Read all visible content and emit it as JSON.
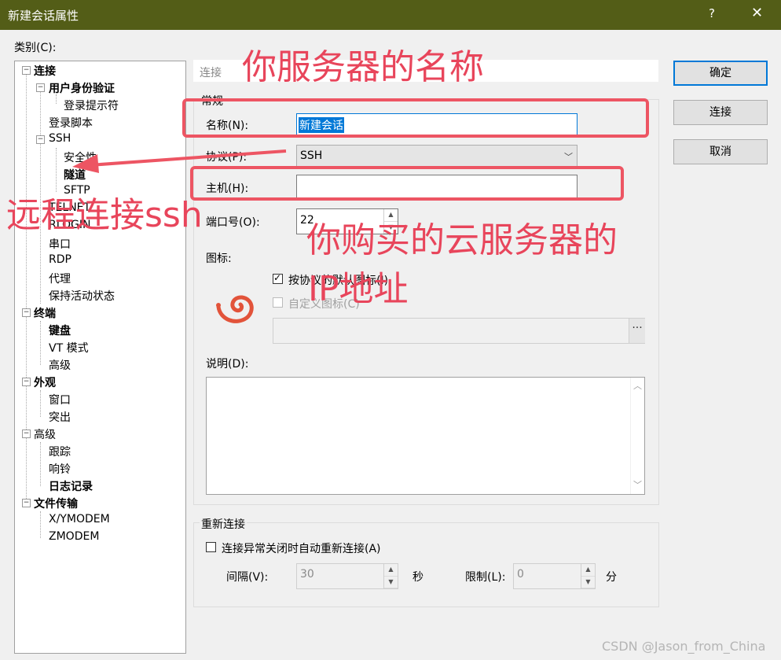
{
  "window": {
    "title": "新建会话属性",
    "help_icon": "?",
    "close_icon": "✕"
  },
  "category_label": "类别(C):",
  "tree": {
    "connection": "连接",
    "user_auth": "用户身份验证",
    "login_prompt": "登录提示符",
    "login_script": "登录脚本",
    "ssh": "SSH",
    "security": "安全性",
    "tunnel": "隧道",
    "sftp": "SFTP",
    "telnet": "TELNET",
    "rlogin": "RLOGIN",
    "serial": "串口",
    "rdp": "RDP",
    "proxy": "代理",
    "keepalive": "保持活动状态",
    "terminal": "终端",
    "keyboard": "键盘",
    "vt_mode": "VT 模式",
    "advanced": "高级",
    "appearance": "外观",
    "window": "窗口",
    "highlight": "突出",
    "advanced2": "高级",
    "trace": "跟踪",
    "bell": "响铃",
    "logging": "日志记录",
    "file_transfer": "文件传输",
    "xymodem": "X/YMODEM",
    "zmodem": "ZMODEM"
  },
  "panel": {
    "header": "连接",
    "general_group": "常规",
    "name_label": "名称(N):",
    "name_value": "新建会话",
    "protocol_label": "协议(P):",
    "protocol_value": "SSH",
    "host_label": "主机(H):",
    "host_value": "",
    "port_label": "端口号(O):",
    "port_value": "22",
    "icon_label": "图标:",
    "use_protocol_icon": "按协议的默认图标(I)",
    "custom_icon": "自定义图标(C)",
    "browse": "...",
    "desc_label": "说明(D):",
    "reconnect_group": "重新连接",
    "reconnect_check": "连接异常关闭时自动重新连接(A)",
    "interval_label": "间隔(V):",
    "interval_value": "30",
    "seconds": "秒",
    "limit_label": "限制(L):",
    "limit_value": "0",
    "minutes": "分"
  },
  "buttons": {
    "ok": "确定",
    "connect": "连接",
    "cancel": "取消"
  },
  "annotations": {
    "server_name": "你服务器的名称",
    "remote_ssh": "远程连接ssh",
    "ip_line1": "你购买的云服务器的",
    "ip_line2": "IP地址"
  },
  "watermark": "CSDN @Jason_from_China",
  "colors": {
    "titlebar": "#535d17",
    "accent": "#0078d7",
    "annotation": "#e8455b"
  }
}
